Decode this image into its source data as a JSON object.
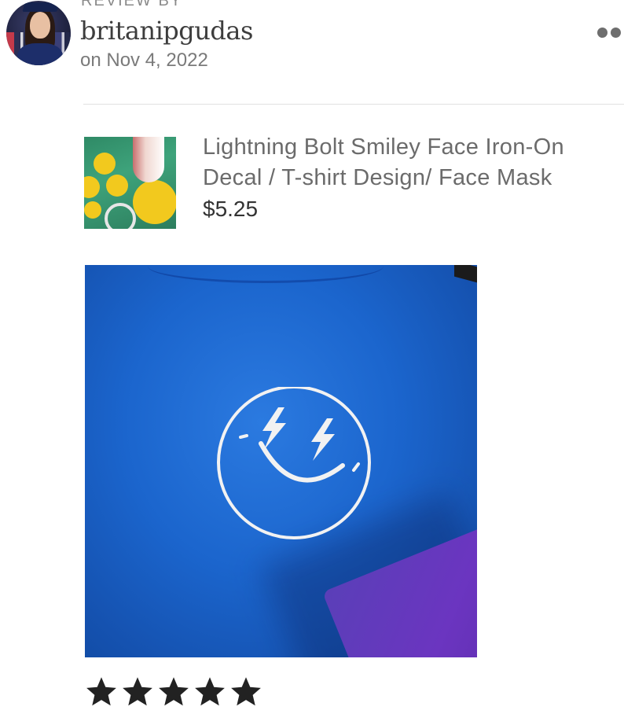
{
  "reviewer": {
    "review_by_label": "REVIEW BY",
    "username": "britanipgudas",
    "date": "on Nov 4, 2022"
  },
  "item": {
    "title": "Lightning Bolt Smiley Face Iron-On Decal / T-shirt Design/ Face Mask",
    "price": "$5.25"
  },
  "rating": {
    "stars": 5,
    "max": 5,
    "star_color": "#222222"
  },
  "icons": {
    "more": "more-dots-icon",
    "star": "star-icon"
  },
  "colors": {
    "shirt_blue": "#1b65cd",
    "purple_fabric": "#6b35c0",
    "decal_white": "#f2f2f2"
  }
}
